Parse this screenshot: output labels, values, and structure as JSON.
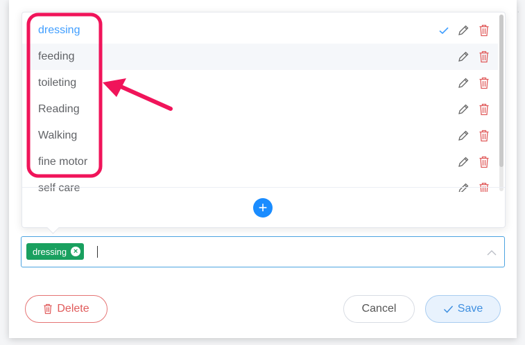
{
  "options": {
    "items": [
      {
        "label": "dressing",
        "selected": true
      },
      {
        "label": "feeding",
        "selected": false
      },
      {
        "label": "toileting",
        "selected": false
      },
      {
        "label": "Reading",
        "selected": false
      },
      {
        "label": "Walking",
        "selected": false
      },
      {
        "label": "fine motor",
        "selected": false
      },
      {
        "label": "self care",
        "selected": false
      }
    ],
    "add_label": "+"
  },
  "select": {
    "tags": [
      {
        "label": "dressing"
      }
    ]
  },
  "footer": {
    "delete_label": "Delete",
    "cancel_label": "Cancel",
    "save_label": "Save"
  },
  "colors": {
    "accent": "#409eff",
    "danger": "#e05a5a",
    "tag": "#19a05f",
    "annotation": "#f0145a"
  },
  "icons": {
    "check": "check-icon",
    "edit": "pencil-icon",
    "delete": "trash-icon",
    "add": "plus-icon",
    "tag_remove": "close-circle-icon",
    "dropdown": "chevron-up-icon"
  }
}
